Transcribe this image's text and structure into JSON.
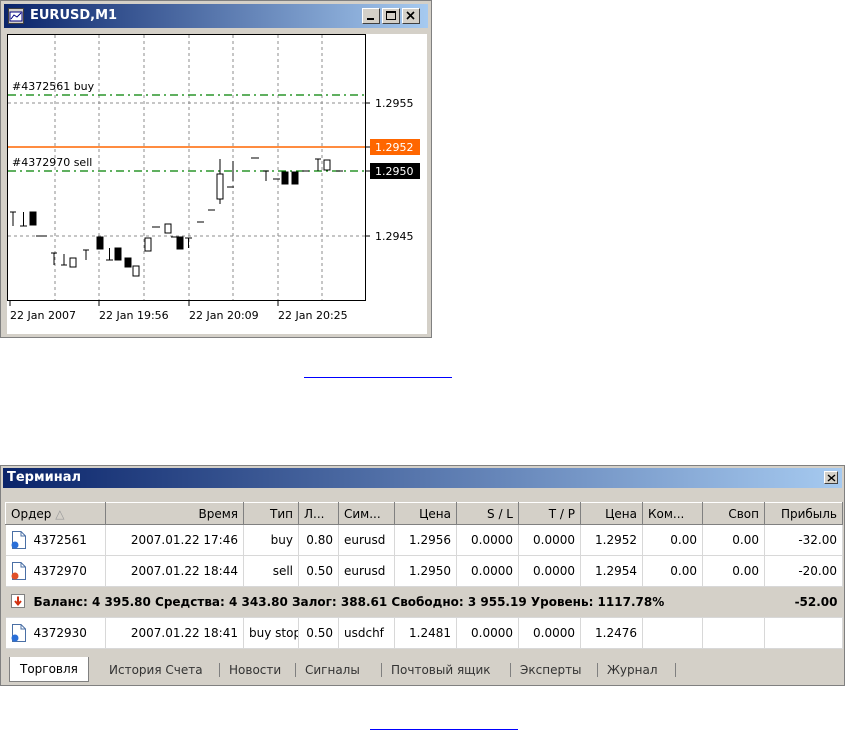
{
  "chart_window": {
    "title": "EURUSD,M1",
    "order_labels": [
      "#4372561 buy",
      "#4372970 sell"
    ],
    "price_labels": [
      "1.2955",
      "1.2952",
      "1.2950",
      "1.2945"
    ],
    "time_labels": [
      "22 Jan 2007",
      "22 Jan 19:56",
      "22 Jan 20:09",
      "22 Jan 20:25"
    ],
    "colors": {
      "order_line": "#008000",
      "bid_line": "#ff6600",
      "bid_label_bg": "#ff6600",
      "sell_label_bg": "#000000"
    }
  },
  "terminal": {
    "title": "Терминал",
    "columns": [
      "Ордер",
      "Время",
      "Тип",
      "Л...",
      "Сим...",
      "Цена",
      "S / L",
      "T / P",
      "Цена",
      "Ком...",
      "Своп",
      "Прибыль"
    ],
    "rows": [
      [
        "4372561",
        "2007.01.22 17:46",
        "buy",
        "0.80",
        "eurusd",
        "1.2956",
        "0.0000",
        "0.0000",
        "1.2952",
        "0.00",
        "0.00",
        "-32.00"
      ],
      [
        "4372970",
        "2007.01.22 18:44",
        "sell",
        "0.50",
        "eurusd",
        "1.2950",
        "0.0000",
        "0.0000",
        "1.2954",
        "0.00",
        "0.00",
        "-20.00"
      ]
    ],
    "summary": {
      "text": "Баланс: 4 395.80 Средства: 4 343.80 Залог: 388.61 Свободно: 3 955.19 Уровень: 1117.78%",
      "profit": "-52.00"
    },
    "pending_row": [
      "4372930",
      "2007.01.22 18:41",
      "buy stop",
      "0.50",
      "usdchf",
      "1.2481",
      "0.0000",
      "0.0000",
      "1.2476",
      "",
      "",
      ""
    ],
    "tabs": [
      "Торговля",
      "История Счета",
      "Новости",
      "Сигналы",
      "Почтовый ящик",
      "Эксперты",
      "Журнал"
    ],
    "active_tab": "Торговля"
  }
}
